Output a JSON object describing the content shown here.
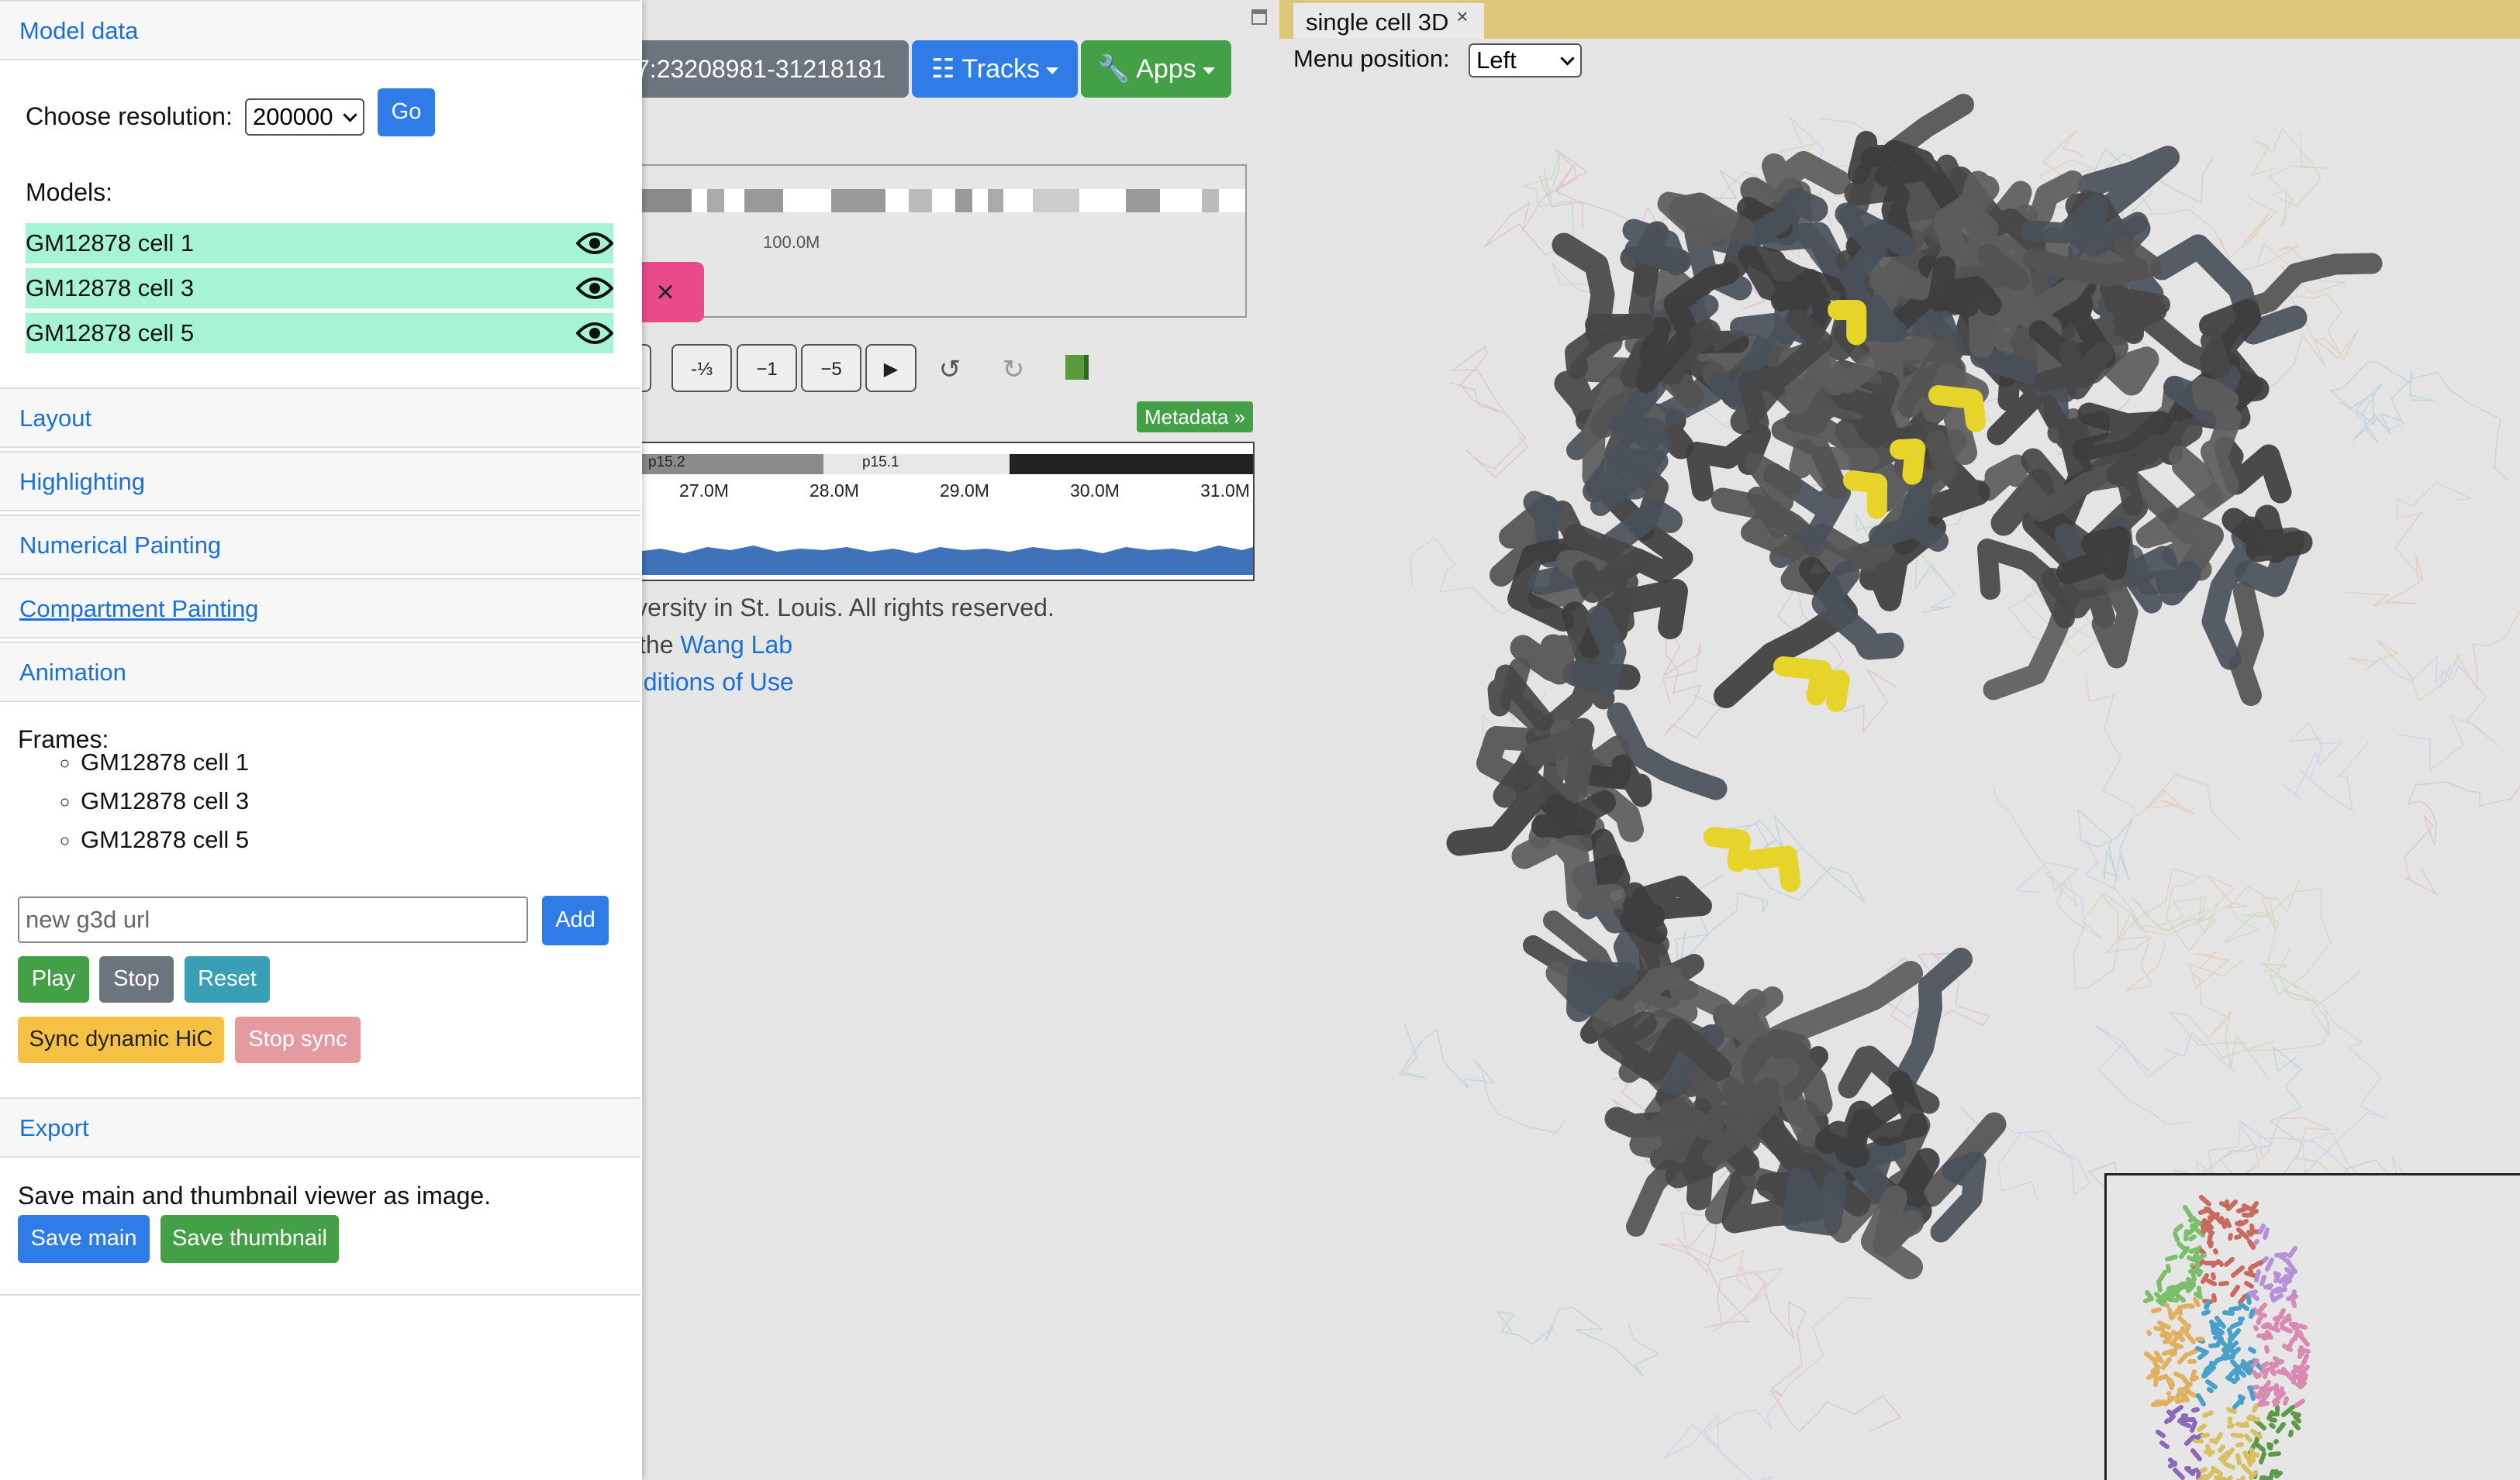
{
  "middle": {
    "locus_text": "7:23208981-31218181",
    "tracks_label": "Tracks",
    "apps_label": "Apps",
    "ideogram_label": "100.0M",
    "close_label": "×",
    "step_buttons": [
      "-⅓",
      "−1",
      "−5"
    ],
    "first_step_partial": "⅓",
    "play_symbol": "▶",
    "undo_symbol": "↺",
    "redo_symbol": "↻",
    "metadata_label": "Metadata »",
    "bands": [
      "p15.2",
      "p15.1"
    ],
    "axis_ticks": [
      "27.0M",
      "28.0M",
      "29.0M",
      "30.0M",
      "31.0M"
    ],
    "footer_line1": "iversity in St. Louis. All rights reserved.",
    "footer_line2_prefix": "the",
    "footer_line2_link": "Wang Lab",
    "footer_line3_link": "nditions of Use"
  },
  "sidebar": {
    "model_data_header": "Model data",
    "choose_resolution_label": "Choose resolution:",
    "resolution_value": "200000",
    "go_label": "Go",
    "models_label": "Models:",
    "models": [
      "GM12878 cell 1",
      "GM12878 cell 3",
      "GM12878 cell 5"
    ],
    "sections": [
      "Layout",
      "Highlighting",
      "Numerical Painting",
      "Compartment Painting",
      "Animation"
    ],
    "frames_label": "Frames:",
    "frames": [
      "GM12878 cell 1",
      "GM12878 cell 3",
      "GM12878 cell 5"
    ],
    "url_placeholder": "new g3d url",
    "add_label": "Add",
    "play_label": "Play",
    "stop_label": "Stop",
    "reset_label": "Reset",
    "sync_label": "Sync dynamic HiC",
    "stop_sync_label": "Stop sync",
    "export_header": "Export",
    "export_text": "Save main and thumbnail viewer as image.",
    "save_main_label": "Save main",
    "save_thumb_label": "Save thumbnail"
  },
  "right": {
    "tab_label": "single cell 3D",
    "tab_close": "×",
    "menu_position_label": "Menu position:",
    "menu_position_value": "Left"
  },
  "colors": {
    "primary": "#2f7be8",
    "success": "#43a047",
    "secondary": "#6c757d",
    "info": "#3a9fb5",
    "warning": "#f5c144",
    "danger_light": "#e59aa0",
    "model_row": "#a6f4d4",
    "highlight": "#e6d42a",
    "tabbar": "#ddc77a"
  }
}
